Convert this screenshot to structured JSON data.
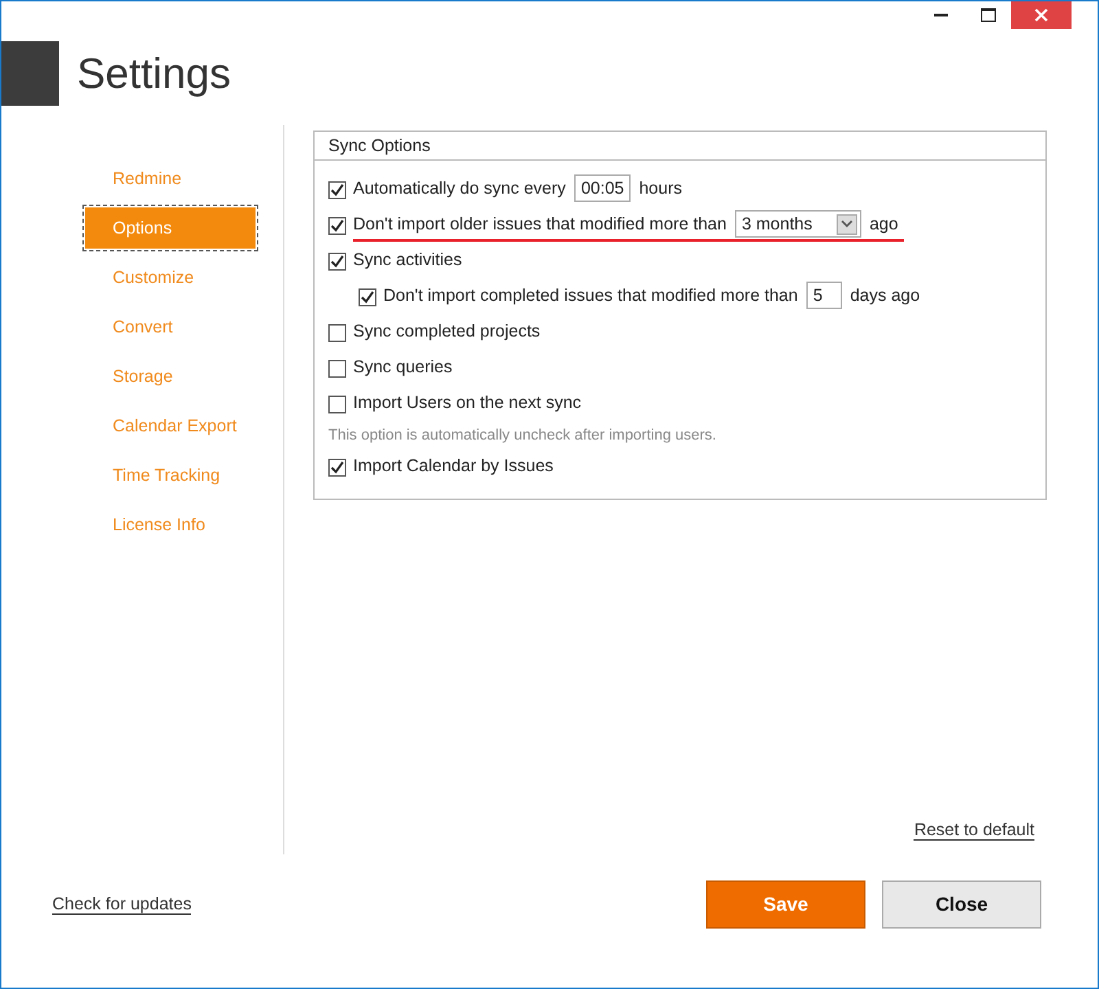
{
  "window": {
    "title": "Settings"
  },
  "sidebar": {
    "items": [
      {
        "label": "Redmine",
        "selected": false
      },
      {
        "label": "Options",
        "selected": true
      },
      {
        "label": "Customize",
        "selected": false
      },
      {
        "label": "Convert",
        "selected": false
      },
      {
        "label": "Storage",
        "selected": false
      },
      {
        "label": "Calendar Export",
        "selected": false
      },
      {
        "label": "Time Tracking",
        "selected": false
      },
      {
        "label": "License Info",
        "selected": false
      }
    ]
  },
  "group": {
    "title": "Sync Options",
    "options": [
      {
        "kind": "input",
        "label": "Automatically do sync every",
        "checked": true,
        "value": "00:05",
        "suffix": "hours",
        "highlighted": false
      },
      {
        "kind": "dropdown",
        "label": "Don't import older issues that modified more than",
        "checked": true,
        "value": "3 months",
        "suffix": "ago",
        "highlighted": true
      },
      {
        "kind": "checkbox",
        "label": "Sync activities",
        "checked": true,
        "highlighted": false,
        "children": [
          {
            "kind": "input",
            "label": "Don't import completed issues that modified more than",
            "checked": true,
            "value": "5",
            "suffix": "days ago",
            "highlighted": false
          }
        ]
      },
      {
        "kind": "checkbox",
        "label": "Sync completed projects",
        "checked": false,
        "highlighted": false
      },
      {
        "kind": "checkbox",
        "label": "Sync queries",
        "checked": false,
        "highlighted": false
      },
      {
        "kind": "checkbox",
        "label": "Import Users on the next sync",
        "checked": false,
        "highlighted": false
      },
      {
        "kind": "note",
        "text": "This option is automatically uncheck after importing users."
      },
      {
        "kind": "checkbox",
        "label": "Import Calendar by Issues",
        "checked": true,
        "highlighted": false
      }
    ]
  },
  "reset_link": "Reset to default",
  "update_link": "Check for updates",
  "buttons": [
    {
      "label": "Save",
      "kind": "primary"
    },
    {
      "label": "Close",
      "kind": "secondary"
    }
  ]
}
